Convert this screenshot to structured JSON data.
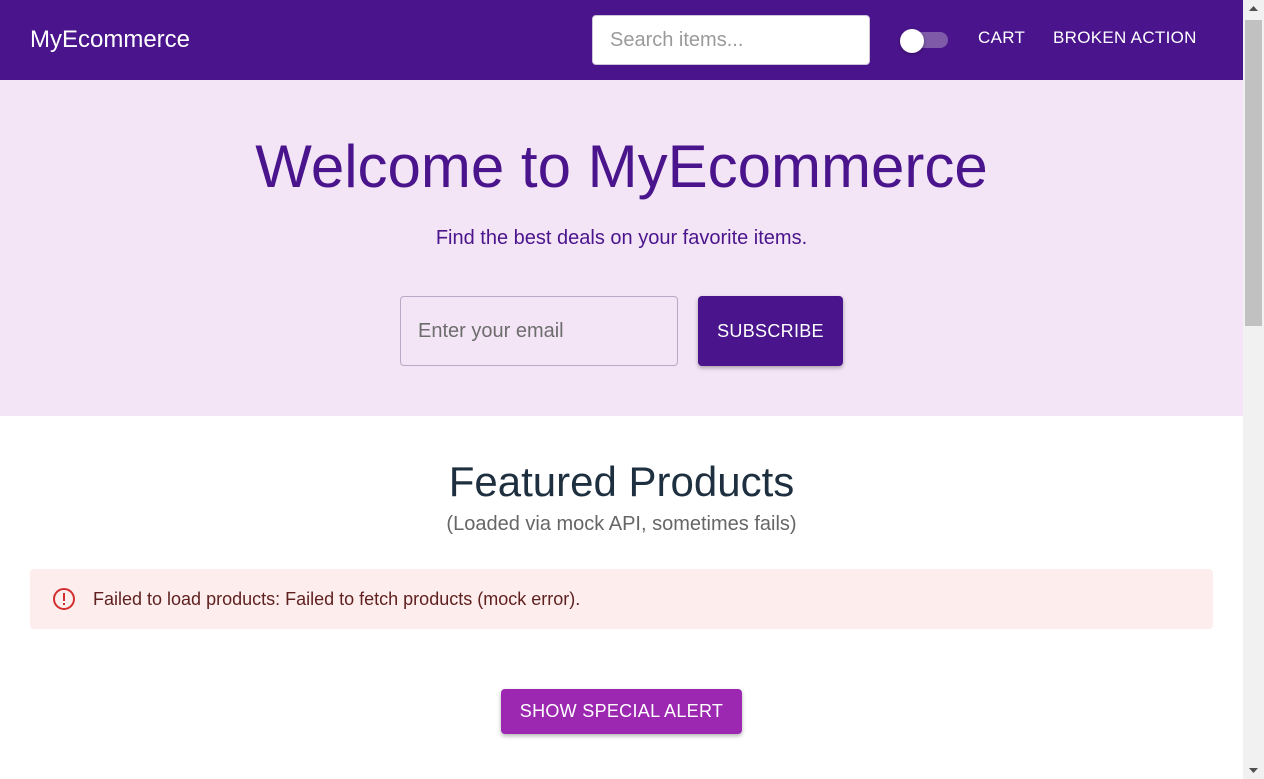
{
  "header": {
    "brand": "MyEcommerce",
    "search_placeholder": "Search items...",
    "theme_toggle": "off",
    "cart_label": "CART",
    "broken_label": "BROKEN ACTION"
  },
  "hero": {
    "title": "Welcome to MyEcommerce",
    "subtitle": "Find the best deals on your favorite items.",
    "email_placeholder": "Enter your email",
    "subscribe_label": "SUBSCRIBE"
  },
  "featured": {
    "title": "Featured Products",
    "subtitle": "(Loaded via mock API, sometimes fails)",
    "error_icon": "error-outline-icon",
    "error_message": "Failed to load products: Failed to fetch products (mock error).",
    "special_alert_label": "SHOW SPECIAL ALERT"
  },
  "colors": {
    "primary": "#4a148c",
    "hero_bg": "#f3e5f5",
    "secondary": "#9c27b0",
    "error_bg": "#fdeded",
    "error_text": "#5f2120",
    "error_icon": "#d32f2f"
  }
}
